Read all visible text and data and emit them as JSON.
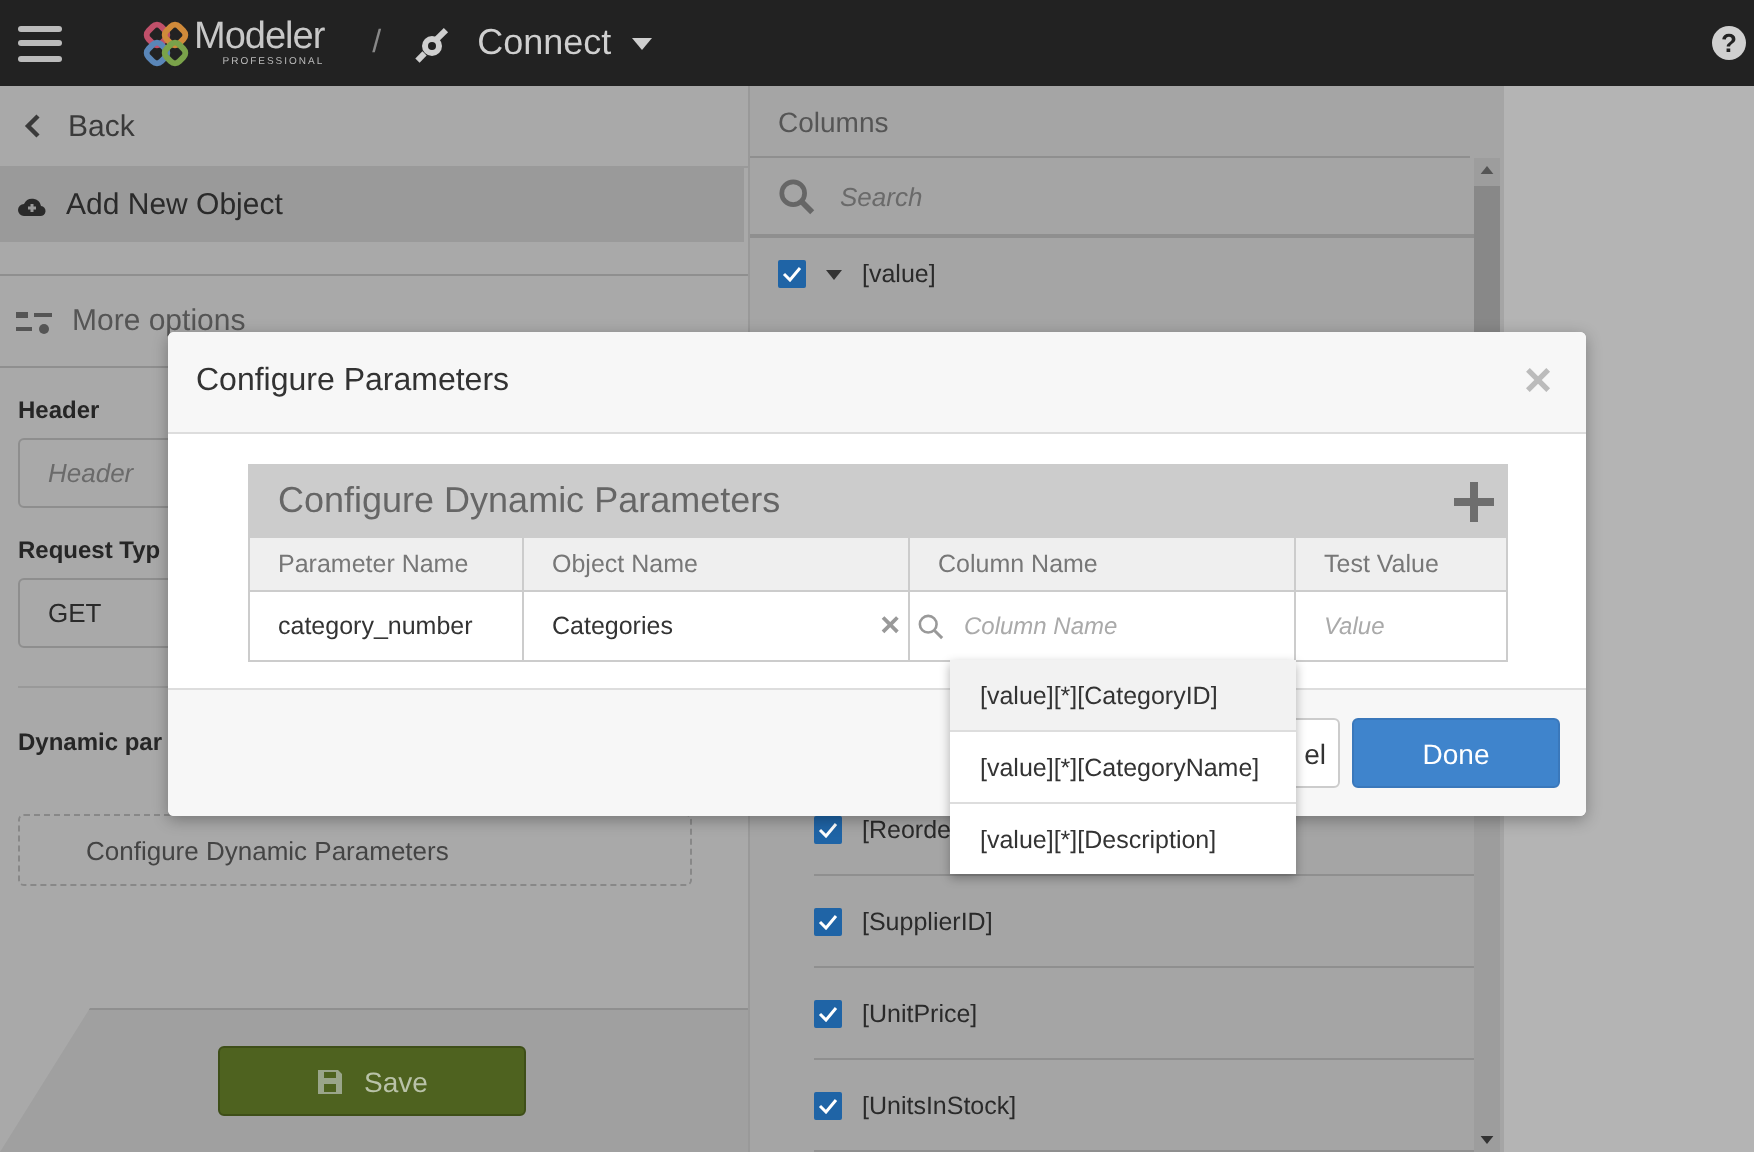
{
  "topbar": {
    "app_name": "Modeler",
    "app_edition": "PROFESSIONAL",
    "separator": "/",
    "section": "Connect",
    "help": "?"
  },
  "left_panel": {
    "back": "Back",
    "add_object": "Add New Object",
    "more_options": "More options",
    "header_label": "Header",
    "header_placeholder": "Header",
    "request_type_label": "Request Typ",
    "request_type_value": "GET",
    "dynamic_label": "Dynamic par",
    "dynamic_button": "Configure Dynamic Parameters",
    "save": "Save"
  },
  "columns_panel": {
    "title": "Columns",
    "search_placeholder": "Search",
    "items": [
      {
        "label": "[value]",
        "checked": true,
        "kind": "parent"
      },
      {
        "label": "[Reorde",
        "checked": true,
        "kind": "field"
      },
      {
        "label": "[SupplierID]",
        "checked": true,
        "kind": "field"
      },
      {
        "label": "[UnitPrice]",
        "checked": true,
        "kind": "field"
      },
      {
        "label": "[UnitsInStock]",
        "checked": true,
        "kind": "field"
      }
    ]
  },
  "dialog": {
    "title": "Configure Parameters",
    "close": "×",
    "table": {
      "title": "Configure Dynamic Parameters",
      "columns": [
        "Parameter Name",
        "Object Name",
        "Column Name",
        "Test Value"
      ],
      "rows": [
        {
          "parameter_name": "category_number",
          "object_name": "Categories",
          "clear": "×",
          "column_name_placeholder": "Column Name",
          "test_value_placeholder": "Value"
        }
      ]
    },
    "dropdown": [
      {
        "label": "[value][*][CategoryID]",
        "selected": true
      },
      {
        "label": "[value][*][CategoryName]",
        "selected": false
      },
      {
        "label": "[value][*][Description]",
        "selected": false
      }
    ],
    "buttons": [
      {
        "label": "el",
        "kind": "secondary"
      },
      {
        "label": "Done",
        "kind": "primary"
      }
    ]
  }
}
